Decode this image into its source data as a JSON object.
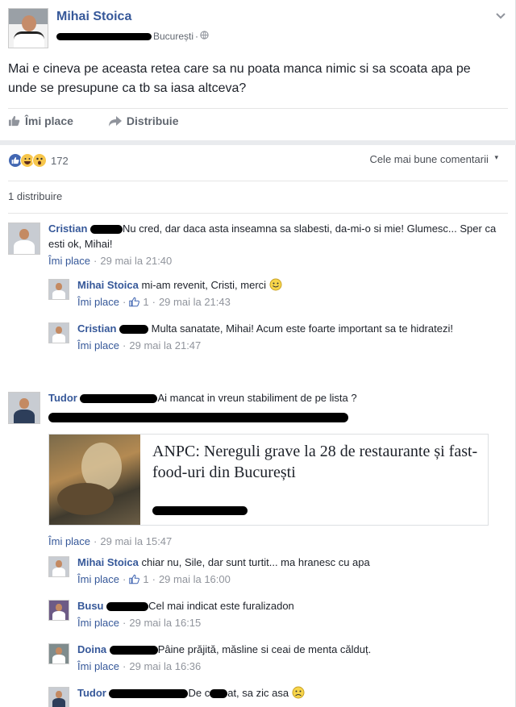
{
  "post": {
    "author": "Mihai Stoica",
    "location": "București",
    "separator": "·",
    "text": "Mai e cineva pe aceasta retea care sa nu poata manca nimic si sa scoata apa pe unde se presupune ca tb sa iasa altceva?",
    "like_label": "Îmi place",
    "share_label": "Distribuie",
    "reaction_count": "172",
    "sort_label": "Cele mai bune comentarii",
    "shares_label": "1 distribuire"
  },
  "comments": [
    {
      "author": "Cristian",
      "text": "Nu cred, dar daca asta inseamna sa slabesti, da-mi-o si mie! Glumesc... Sper ca esti ok, Mihai!",
      "like": "Îmi place",
      "time": "29 mai la 21:40",
      "replies": [
        {
          "author": "Mihai Stoica",
          "text": "mi-am revenit, Cristi, merci",
          "like": "Îmi place",
          "likes": "1",
          "time": "29 mai la 21:43"
        },
        {
          "author": "Cristian",
          "text": "Multa sanatate, Mihai! Acum este foarte important sa te hidratezi!",
          "like": "Îmi place",
          "time": "29 mai la 21:47"
        }
      ]
    },
    {
      "author": "Tudor",
      "text": "Ai mancat in vreun stabiliment de pe lista ?",
      "preview_title": "ANPC: Nereguli grave la 28 de restaurante și fast-food-uri din București",
      "like": "Îmi place",
      "time": "29 mai la 15:47",
      "replies": [
        {
          "author": "Mihai Stoica",
          "text": "chiar nu, Sile, dar sunt turtit... ma hranesc cu apa",
          "like": "Îmi place",
          "likes": "1",
          "time": "29 mai la 16:00"
        },
        {
          "author": "Busu",
          "text": "Cel mai indicat este furalizadon",
          "like": "Îmi place",
          "time": "29 mai la 16:15"
        },
        {
          "author": "Doina",
          "text": "Pâine prăjită, măsline si ceai de menta călduț.",
          "like": "Îmi place",
          "time": "29 mai la 16:36"
        },
        {
          "author": "Tudor",
          "text": "De c",
          "text_after": "at, sa zic asa"
        }
      ]
    }
  ],
  "icons": {
    "globe": "globe-icon",
    "chevron": "chevron-down-icon",
    "thumb": "thumbs-up-icon",
    "share": "share-arrow-icon",
    "smile": "smile-emoji-icon",
    "sad": "sad-emoji-icon"
  },
  "colors": {
    "link": "#365899",
    "muted": "#90949c",
    "like_badge": "#4267b2"
  }
}
